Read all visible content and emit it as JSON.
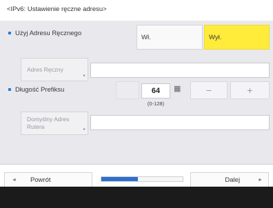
{
  "title": "<IPv6: Ustawienie ręczne adresu>",
  "manual_address": {
    "label": "Użyj Adresu Ręcznego",
    "on_label": "Wł.",
    "off_label": "Wył.",
    "selected": "off"
  },
  "address_field": {
    "button_label": "Adres Ręczny",
    "value": ""
  },
  "prefix": {
    "label": "Długość Prefiksu",
    "value": "64",
    "range": "(0-128)",
    "minus": "−",
    "plus": "+"
  },
  "router_field": {
    "button_label": "Domyślny Adres Rutera",
    "value": ""
  },
  "footer": {
    "back_label": "Powrót",
    "next_label": "Dalej",
    "back_arrow": "◄",
    "next_arrow": "►",
    "progress_fraction": 0.45
  },
  "colors": {
    "selected": "#ffec3a",
    "accent": "#2b7fd0",
    "progress": "#2f6fcc"
  },
  "icons": {
    "keypad": "keypad-icon"
  }
}
